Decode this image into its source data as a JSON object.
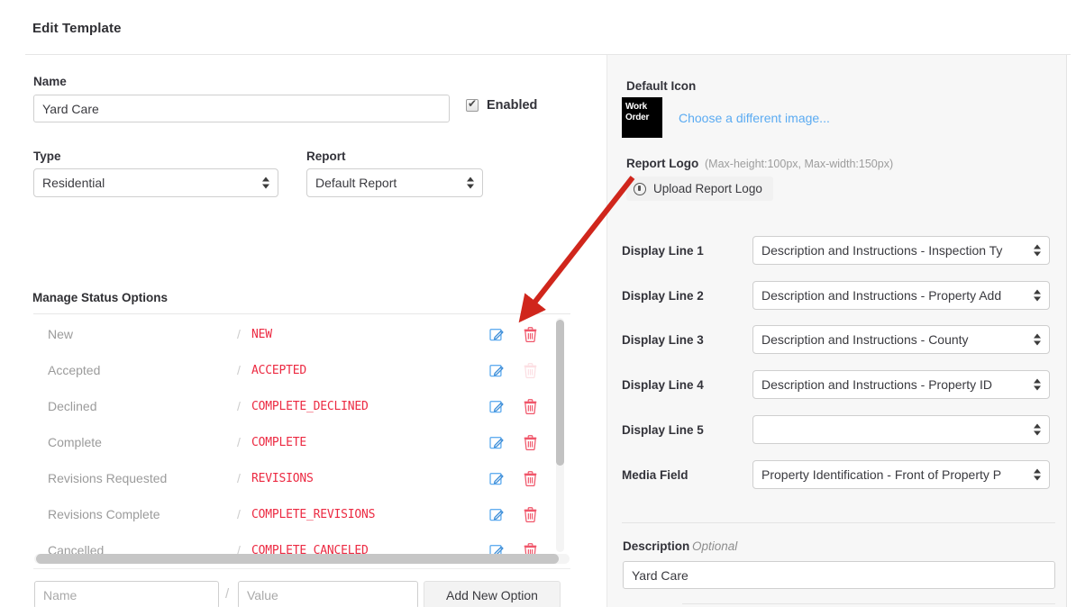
{
  "page": {
    "title": "Edit Template"
  },
  "left": {
    "name": {
      "label": "Name",
      "value": "Yard Care"
    },
    "enabled": {
      "label": "Enabled",
      "checked": true
    },
    "type": {
      "label": "Type",
      "value": "Residential"
    },
    "report": {
      "label": "Report",
      "value": "Default Report"
    },
    "status_section": {
      "title": "Manage Status Options",
      "separator": "/",
      "rows": [
        {
          "name": "New",
          "value": "NEW",
          "delete_enabled": true
        },
        {
          "name": "Accepted",
          "value": "ACCEPTED",
          "delete_enabled": false
        },
        {
          "name": "Declined",
          "value": "COMPLETE_DECLINED",
          "delete_enabled": true
        },
        {
          "name": "Complete",
          "value": "COMPLETE",
          "delete_enabled": true
        },
        {
          "name": "Revisions Requested",
          "value": "REVISIONS",
          "delete_enabled": true
        },
        {
          "name": "Revisions Complete",
          "value": "COMPLETE_REVISIONS",
          "delete_enabled": true
        },
        {
          "name": "Cancelled",
          "value": "COMPLETE_CANCELED",
          "delete_enabled": true
        }
      ]
    },
    "add_option": {
      "name_placeholder": "Name",
      "value_placeholder": "Value",
      "separator": "/",
      "button_label": "Add New Option"
    }
  },
  "right": {
    "default_icon": {
      "label": "Default Icon",
      "icon_line1": "Work",
      "icon_line2": "Order",
      "choose_link": "Choose a different image..."
    },
    "report_logo": {
      "label": "Report Logo",
      "hint": "(Max-height:100px, Max-width:150px)",
      "upload_label": "Upload Report Logo"
    },
    "display_lines": [
      {
        "label": "Display Line 1",
        "value": "Description and Instructions - Inspection Ty"
      },
      {
        "label": "Display Line 2",
        "value": "Description and Instructions - Property Add"
      },
      {
        "label": "Display Line 3",
        "value": "Description and Instructions - County"
      },
      {
        "label": "Display Line 4",
        "value": "Description and Instructions - Property ID"
      },
      {
        "label": "Display Line 5",
        "value": ""
      },
      {
        "label": "Media Field",
        "value": "Property Identification - Front of Property P"
      }
    ],
    "description": {
      "label": "Description",
      "optional": "Optional",
      "value": "Yard Care"
    }
  },
  "colors": {
    "accent_red": "#ec2a42",
    "link_blue": "#5babf2",
    "annotation_red": "#d0261c",
    "panel_bg": "#f7f7f7"
  }
}
